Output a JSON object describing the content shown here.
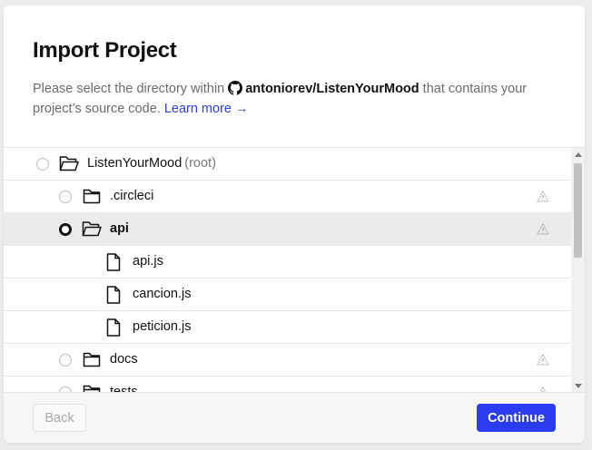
{
  "dialog": {
    "title": "Import Project",
    "desc_prefix": "Please select the directory within",
    "repo": "antoniorev/ListenYourMood",
    "desc_suffix": "that contains your project’s source code.",
    "learn_more": "Learn more →"
  },
  "tree": {
    "root": {
      "name": "ListenYourMood",
      "suffix": "(root)",
      "selected": false
    },
    "items": [
      {
        "name": ".circleci",
        "type": "folder",
        "selected": false,
        "warning": true
      },
      {
        "name": "api",
        "type": "folder",
        "selected": true,
        "warning": true,
        "expanded": true
      },
      {
        "name": "api.js",
        "type": "file"
      },
      {
        "name": "cancion.js",
        "type": "file"
      },
      {
        "name": "peticion.js",
        "type": "file"
      },
      {
        "name": "docs",
        "type": "folder",
        "selected": false,
        "warning": true
      },
      {
        "name": "tests",
        "type": "folder",
        "selected": false,
        "warning": true
      }
    ]
  },
  "footer": {
    "back_label": "Back",
    "continue_label": "Continue"
  },
  "colors": {
    "accent": "#2b3bf0",
    "link": "#2f41d8",
    "selected_row": "#ebebeb"
  }
}
